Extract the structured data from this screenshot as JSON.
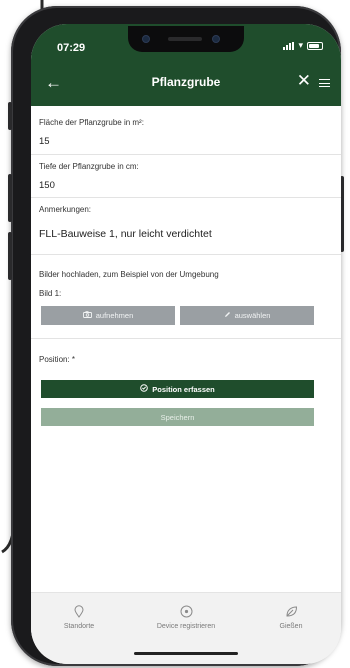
{
  "status_bar": {
    "time": "07:29"
  },
  "header": {
    "back_glyph": "←",
    "title": "Pflanzgrube",
    "close_glyph": "✕"
  },
  "form": {
    "area": {
      "label": "Fläche der Pflanzgrube in m²:",
      "value": "15"
    },
    "depth": {
      "label": "Tiefe der Pflanzgrube in cm:",
      "value": "150"
    },
    "notes": {
      "label": "Anmerkungen:",
      "value": "FLL-Bauweise 1, nur leicht verdichtet"
    },
    "images": {
      "label": "Bilder hochladen, zum Beispiel von der Umgebung",
      "image1_label": "Bild 1:",
      "capture_label": "aufnehmen",
      "capture_icon": "camera-icon",
      "select_label": "auswählen",
      "select_icon": "pencil-icon"
    },
    "position": {
      "label": "Position: *",
      "capture_button": "Position erfassen",
      "capture_icon": "location-target-icon"
    },
    "save_button": "Speichern"
  },
  "tabbar": {
    "items": [
      {
        "label": "Standorte",
        "icon": "map-pin-icon"
      },
      {
        "label": "Device registrieren",
        "icon": "target-icon"
      },
      {
        "label": "Gießen",
        "icon": "leaf-icon"
      }
    ]
  },
  "colors": {
    "brand_green": "#1f4d2c",
    "disabled_green": "#93ae99",
    "gray_button": "#9a9fa3",
    "tabbar_bg": "#f2f2f2"
  }
}
